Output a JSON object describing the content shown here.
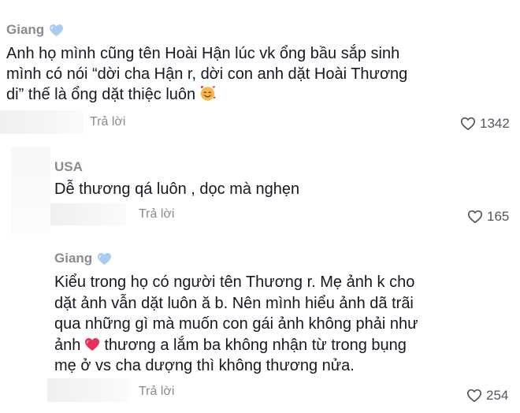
{
  "comments": [
    {
      "username": "Giang",
      "badge_icon": "blue-heart-icon",
      "text_lines": [
        "Anh họ mình cũng tên Hoài Hận lúc vk ổng bầu sắp sinh",
        "mình có nói “dời cha Hận r, dời con anh dặt Hoài Thương",
        "di” thế là ổng dặt thiệc luôn"
      ],
      "emoji_icon": "smiling-face-with-hearts-icon",
      "reply_label": "Trả lời",
      "likes": "1342"
    },
    {
      "username": "USA",
      "text_lines": [
        "Dễ thương qá luôn , dọc mà nghẹn"
      ],
      "reply_label": "Trả lời",
      "likes": "165"
    },
    {
      "username": "Giang",
      "badge_icon": "blue-heart-icon",
      "text_lines": [
        "Kiểu trong họ có người tên Thương r. Mẹ ảnh k cho",
        "dặt ảnh vẫn dặt luôn ă b. Nên mình hiểu ảnh dã trãi",
        "qua những gì mà muốn con gái ảnh không phải như",
        "ảnh",
        "thương a lắm ba không nhận từ trong bụng",
        "mẹ ở vs cha dượng thì không thương nửa."
      ],
      "inline_emoji_icon": "red-heart-icon",
      "reply_label": "Trả lời",
      "likes": "254"
    }
  ],
  "colors": {
    "username": "#8a8b91",
    "text": "#161823",
    "like_icon": "#545560",
    "blue_heart": "#a9cdf2",
    "red_heart": "#e8315a"
  }
}
